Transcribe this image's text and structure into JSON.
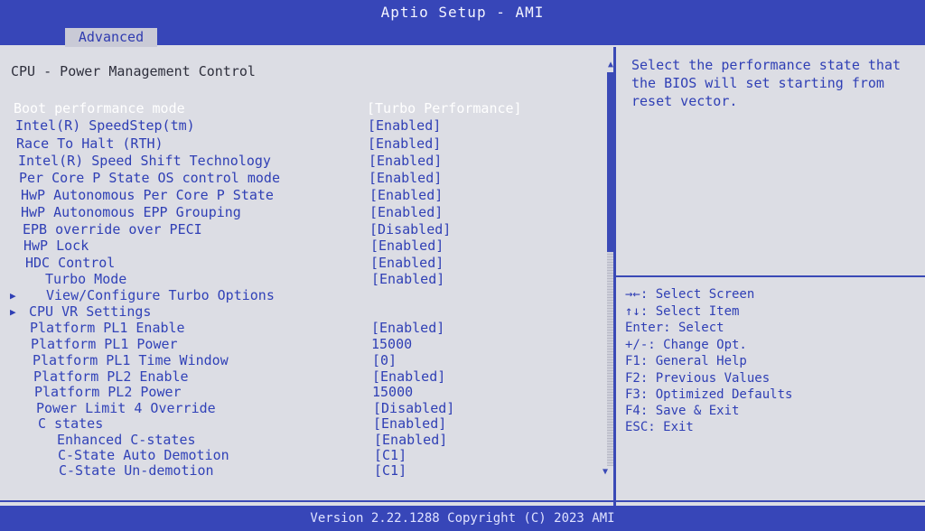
{
  "window": {
    "title": "Aptio Setup - AMI"
  },
  "tabs": [
    {
      "label": "Advanced"
    }
  ],
  "section": {
    "title": "CPU - Power Management Control"
  },
  "settings": [
    {
      "label": "Boot performance mode",
      "value": "[Turbo Performance]"
    },
    {
      "label": "Intel(R) SpeedStep(tm)",
      "value": "[Enabled]"
    },
    {
      "label": "Race To Halt (RTH)",
      "value": "[Enabled]"
    },
    {
      "label": "Intel(R) Speed Shift Technology",
      "value": "[Enabled]"
    },
    {
      "label": "Per Core P State OS control mode",
      "value": "[Enabled]"
    },
    {
      "label": "HwP Autonomous Per Core P State",
      "value": "[Enabled]"
    },
    {
      "label": "HwP Autonomous EPP Grouping",
      "value": "[Enabled]"
    },
    {
      "label": "EPB override over PECI",
      "value": "[Disabled]"
    },
    {
      "label": "HwP Lock",
      "value": "[Enabled]"
    },
    {
      "label": "HDC Control",
      "value": "[Enabled]"
    },
    {
      "label": "Turbo Mode",
      "value": "[Enabled]"
    },
    {
      "label": "View/Configure Turbo Options",
      "value": ""
    },
    {
      "label": "CPU VR Settings",
      "value": ""
    },
    {
      "label": "Platform PL1 Enable",
      "value": "[Enabled]"
    },
    {
      "label": "Platform PL1 Power",
      "value": "15000"
    },
    {
      "label": "Platform PL1 Time Window",
      "value": "[0]"
    },
    {
      "label": "Platform PL2 Enable",
      "value": "[Enabled]"
    },
    {
      "label": "Platform PL2 Power",
      "value": "15000"
    },
    {
      "label": "Power Limit 4 Override",
      "value": "[Disabled]"
    },
    {
      "label": "C states",
      "value": "[Enabled]"
    },
    {
      "label": "Enhanced C-states",
      "value": "[Enabled]"
    },
    {
      "label": "C-State Auto Demotion",
      "value": "[C1]"
    },
    {
      "label": "C-State Un-demotion",
      "value": "[C1]"
    }
  ],
  "help": {
    "text": "Select the performance state that the BIOS will set starting from reset vector."
  },
  "keys": [
    "→←: Select Screen",
    "↑↓: Select Item",
    "Enter: Select",
    "+/-: Change Opt.",
    "F1: General Help",
    "F2: Previous Values",
    "F3: Optimized Defaults",
    "F4: Save & Exit",
    "ESC: Exit"
  ],
  "footer": {
    "version": "Version 2.22.1288 Copyright (C) 2023 AMI"
  },
  "icons": {
    "submenu": "triangle-right-icon",
    "scroll_up": "triangle-up-icon",
    "scroll_down": "triangle-down-icon"
  },
  "colors": {
    "accent": "#3746b8",
    "text": "#2f3fb5",
    "background": "#dcdde4",
    "selected": "#ffffff"
  }
}
